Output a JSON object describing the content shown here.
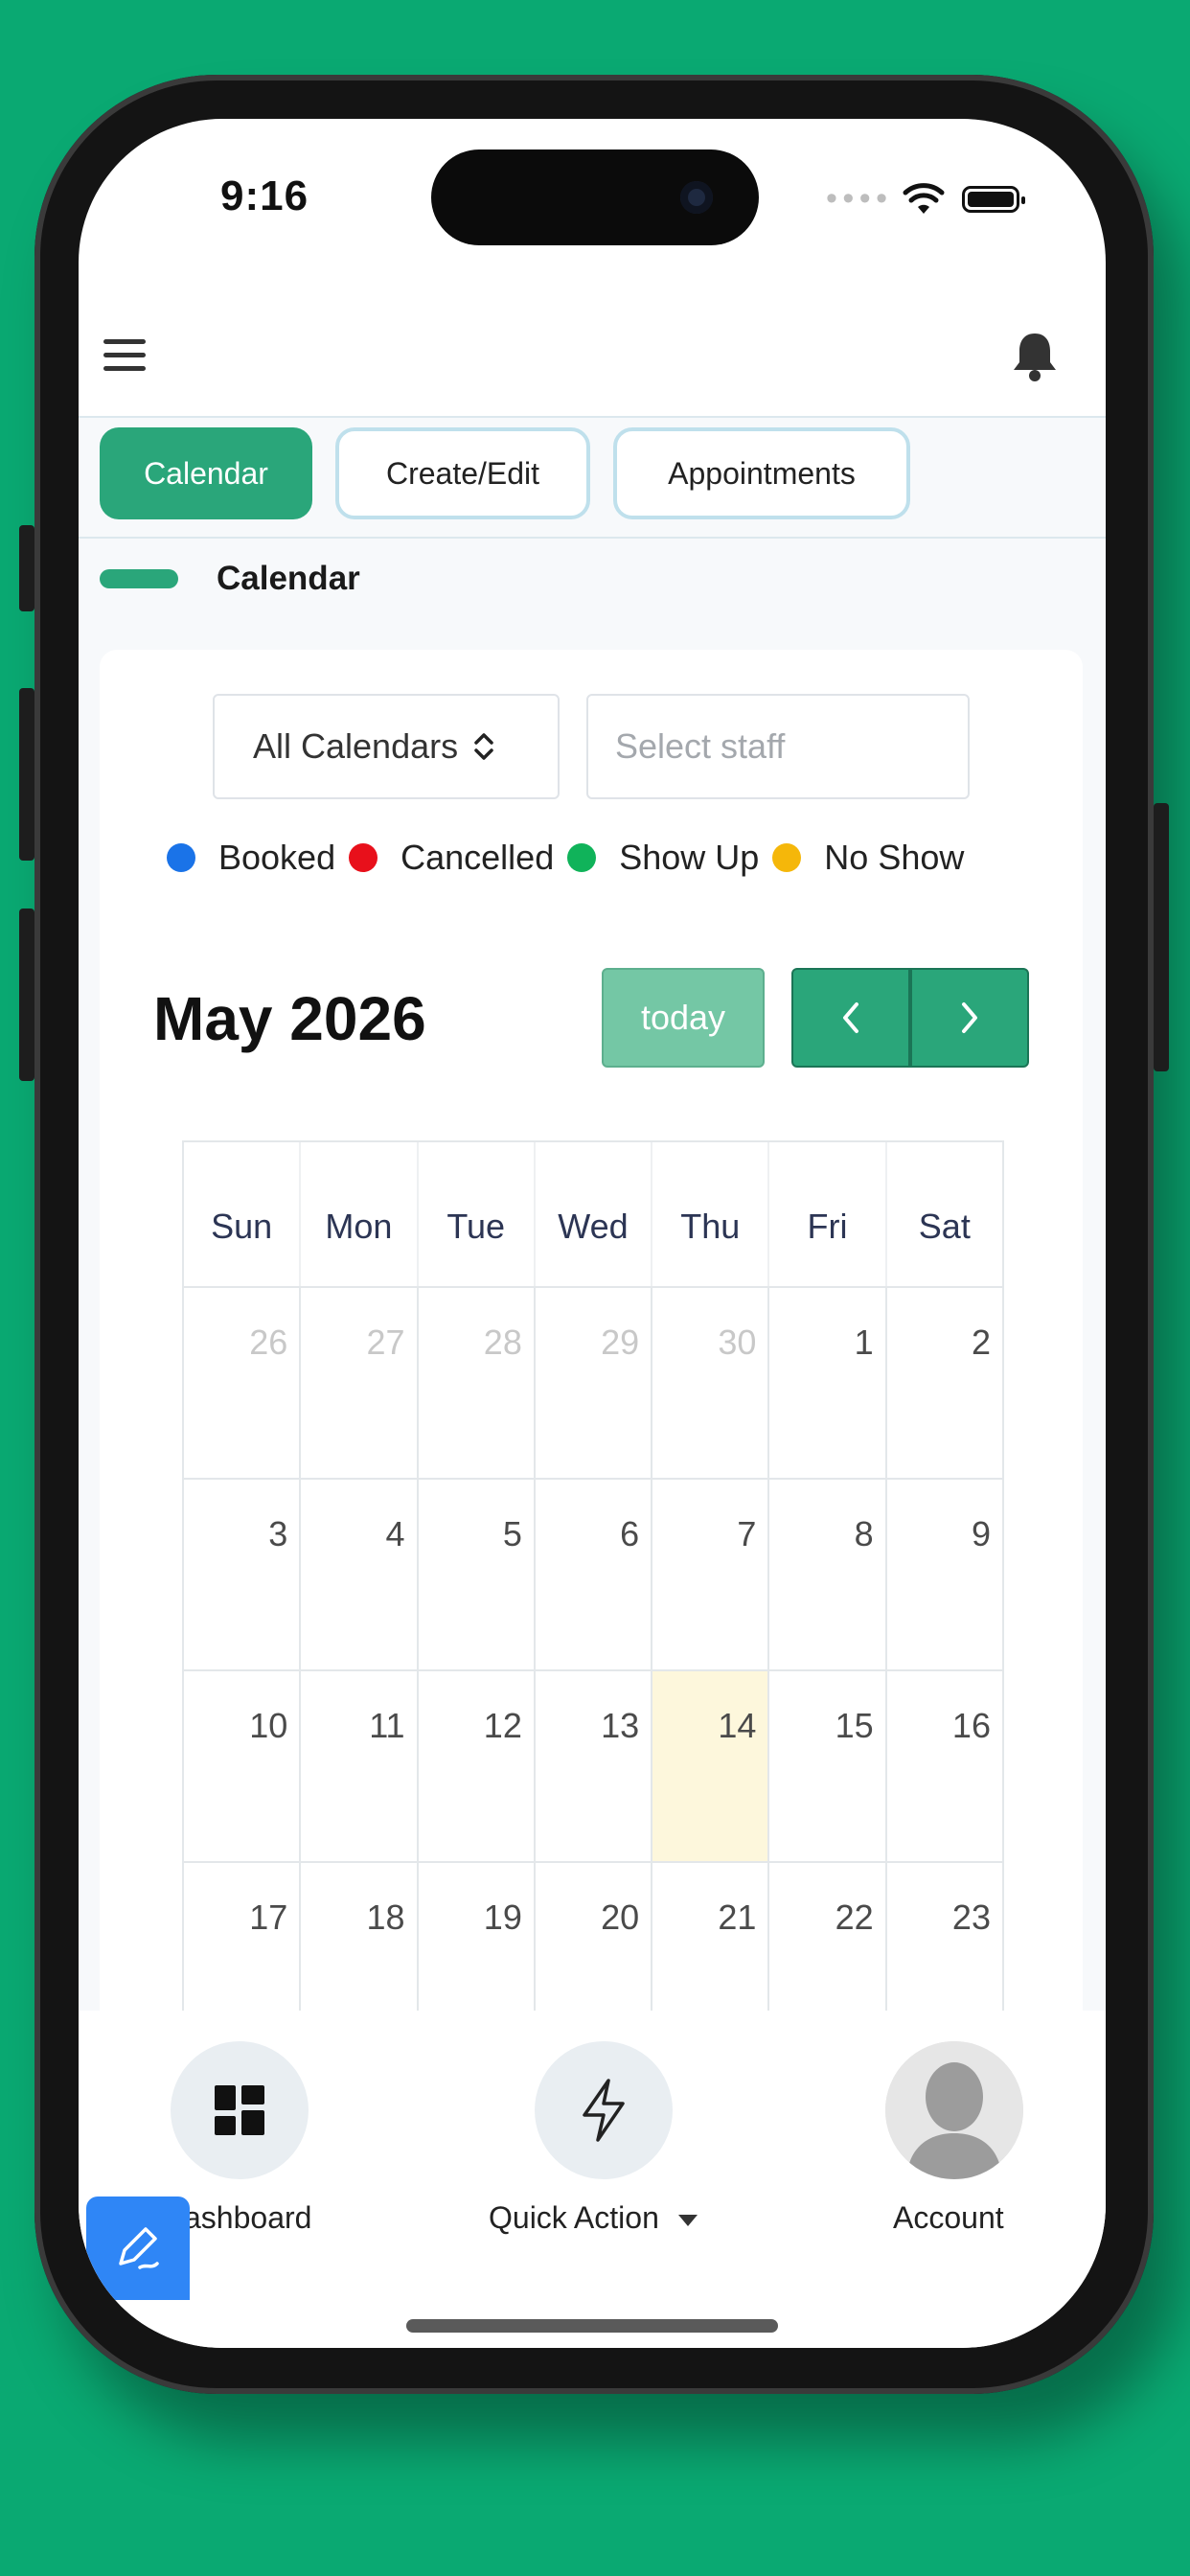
{
  "status": {
    "time": "9:16",
    "icons": [
      "signal-dots-icon",
      "wifi-icon",
      "battery-icon"
    ]
  },
  "header": {
    "menu_icon": "hamburger-icon",
    "notification_icon": "bell-icon"
  },
  "tabs": [
    {
      "label": "Calendar",
      "active": true
    },
    {
      "label": "Create/Edit",
      "active": false
    },
    {
      "label": "Appointments",
      "active": false
    }
  ],
  "section": {
    "title": "Calendar"
  },
  "filters": {
    "calendar_select": "All Calendars",
    "staff_placeholder": "Select staff"
  },
  "legend": [
    {
      "label": "Booked",
      "color": "#1a73e8"
    },
    {
      "label": "Cancelled",
      "color": "#e8101b"
    },
    {
      "label": "Show Up",
      "color": "#10b35a"
    },
    {
      "label": "No Show",
      "color": "#f5b70a"
    }
  ],
  "calendar": {
    "title": "May 2026",
    "today_label": "today",
    "weekdays": [
      "Sun",
      "Mon",
      "Tue",
      "Wed",
      "Thu",
      "Fri",
      "Sat"
    ],
    "weeks": [
      [
        "26",
        "27",
        "28",
        "29",
        "30",
        "1",
        "2"
      ],
      [
        "3",
        "4",
        "5",
        "6",
        "7",
        "8",
        "9"
      ],
      [
        "10",
        "11",
        "12",
        "13",
        "14",
        "15",
        "16"
      ],
      [
        "17",
        "18",
        "19",
        "20",
        "21",
        "22",
        "23"
      ]
    ],
    "today": "14"
  },
  "bottom_nav": {
    "dashboard": "ashboard",
    "quick_action": "Quick Action",
    "account": "Account"
  },
  "colors": {
    "accent": "#2aa67a",
    "background": "#0aa972",
    "fab": "#2f86f6"
  }
}
